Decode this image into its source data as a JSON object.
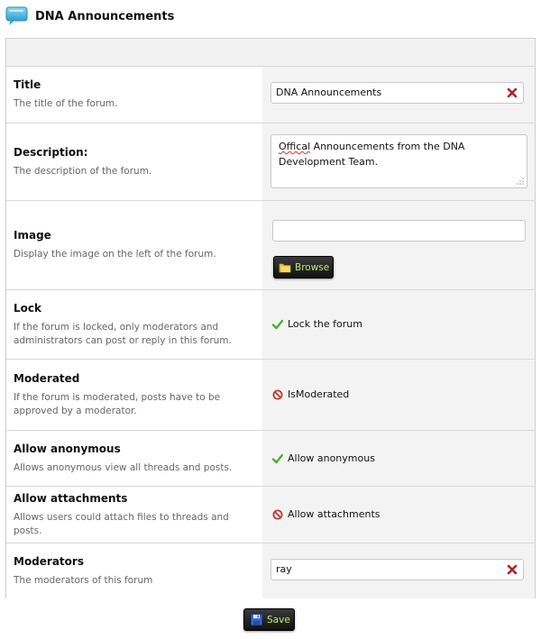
{
  "page": {
    "title": "DNA Announcements"
  },
  "fields": {
    "title": {
      "label": "Title",
      "description": "The title of the forum.",
      "value": "DNA Announcements"
    },
    "description": {
      "label": "Description:",
      "description": "The description of the forum.",
      "value_misspelled": "Offical",
      "value_rest": " Announcements from the DNA Development Team."
    },
    "image": {
      "label": "Image",
      "description": "Display the image on the left of the forum.",
      "value": "",
      "browse_label": "Browse"
    },
    "lock": {
      "label": "Lock",
      "description": "If the forum is locked, only moderators and administrators can post or reply in this forum.",
      "option_label": "Lock the forum",
      "checked": true
    },
    "moderated": {
      "label": "Moderated",
      "description": "If the forum is moderated, posts have to be approved by a moderator.",
      "option_label": "IsModerated",
      "checked": false
    },
    "anonymous": {
      "label": "Allow anonymous",
      "description": "Allows anonymous view all threads and posts.",
      "option_label": "Allow anonymous",
      "checked": true
    },
    "attachments": {
      "label": "Allow attachments",
      "description": "Allows users could attach files to threads and posts.",
      "option_label": "Allow attachments",
      "checked": false
    },
    "moderators": {
      "label": "Moderators",
      "description": "The moderators of this forum",
      "value": "ray"
    }
  },
  "actions": {
    "save_label": "Save"
  },
  "colors": {
    "check": "#4caf2a",
    "no": "#c0392b",
    "clear": "#b22222",
    "button_text": "#c6e86a"
  },
  "icons": {
    "header": "speech-bubble-icon",
    "browse": "folder-icon",
    "save": "floppy-disk-icon",
    "clear": "close-icon",
    "checked": "check-icon",
    "unchecked": "no-entry-icon"
  }
}
